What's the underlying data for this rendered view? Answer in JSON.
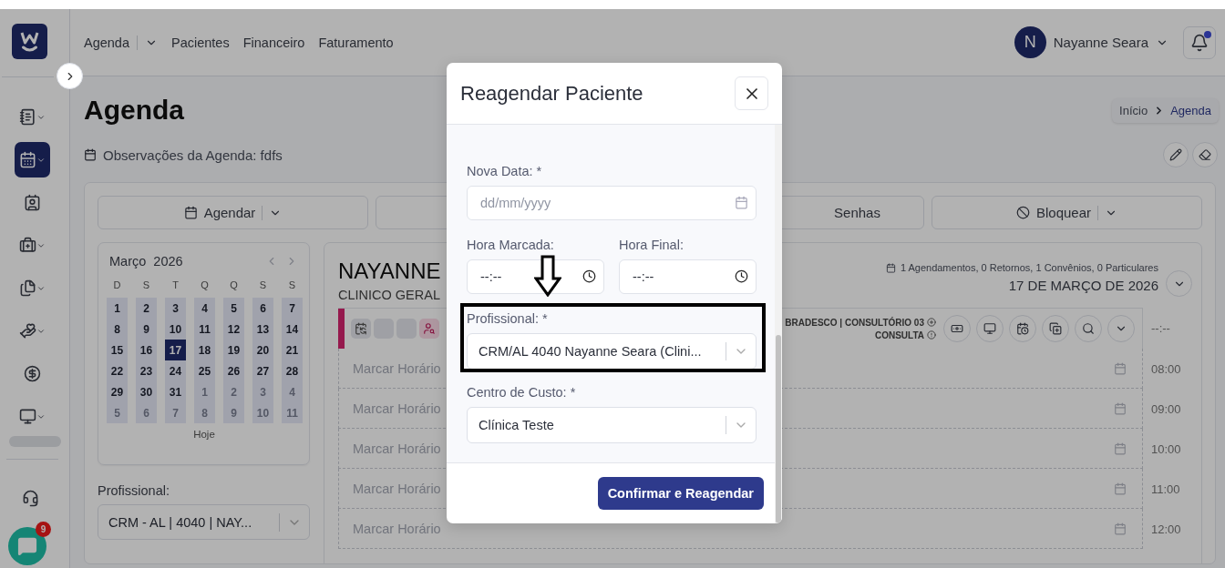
{
  "nav": {
    "links": [
      {
        "label": "Agenda",
        "dropdown": true
      },
      {
        "label": "Pacientes",
        "dropdown": false
      },
      {
        "label": "Financeiro",
        "dropdown": false
      },
      {
        "label": "Faturamento",
        "dropdown": false
      }
    ]
  },
  "user": {
    "initial": "N",
    "name": "Nayanne Seara"
  },
  "notifications": {
    "unread": true
  },
  "sidebar": {
    "items": [
      {
        "dropdown": true,
        "selected": false
      },
      {
        "dropdown": true,
        "selected": true
      },
      {
        "dropdown": false,
        "selected": false
      },
      {
        "dropdown": true,
        "selected": false
      },
      {
        "dropdown": true,
        "selected": false
      },
      {
        "dropdown": true,
        "selected": false
      },
      {
        "dropdown": false,
        "selected": false
      },
      {
        "dropdown": true,
        "selected": false
      }
    ]
  },
  "chat": {
    "badge": "9"
  },
  "page": {
    "title": "Agenda",
    "notes": "Observações da Agenda: fdfs",
    "breadcrumb": [
      {
        "label": "Início",
        "current": false
      },
      {
        "label": "Agenda",
        "current": true
      }
    ]
  },
  "actions": [
    {
      "label": "Agendar",
      "dropdown": true
    },
    {
      "label": "Senhas"
    },
    {
      "label": "Bloquear",
      "dropdown": true
    }
  ],
  "calendar": {
    "month": "Março",
    "year": "2026",
    "weekdays": [
      "D",
      "S",
      "T",
      "Q",
      "Q",
      "S",
      "S"
    ],
    "today": "Hoje",
    "weeks": [
      [
        {
          "day": "1",
          "outside": false,
          "selected": false
        },
        {
          "day": "2",
          "outside": false,
          "selected": false
        },
        {
          "day": "3",
          "outside": false,
          "selected": false
        },
        {
          "day": "4",
          "outside": false,
          "selected": false
        },
        {
          "day": "5",
          "outside": false,
          "selected": false
        },
        {
          "day": "6",
          "outside": false,
          "selected": false
        },
        {
          "day": "7",
          "outside": false,
          "selected": false
        }
      ],
      [
        {
          "day": "8",
          "outside": false,
          "selected": false
        },
        {
          "day": "9",
          "outside": false,
          "selected": false
        },
        {
          "day": "10",
          "outside": false,
          "selected": false
        },
        {
          "day": "11",
          "outside": false,
          "selected": false
        },
        {
          "day": "12",
          "outside": false,
          "selected": false
        },
        {
          "day": "13",
          "outside": false,
          "selected": false
        },
        {
          "day": "14",
          "outside": false,
          "selected": false
        }
      ],
      [
        {
          "day": "15",
          "outside": false,
          "selected": false
        },
        {
          "day": "16",
          "outside": false,
          "selected": false
        },
        {
          "day": "17",
          "outside": false,
          "selected": true
        },
        {
          "day": "18",
          "outside": false,
          "selected": false
        },
        {
          "day": "19",
          "outside": false,
          "selected": false
        },
        {
          "day": "20",
          "outside": false,
          "selected": false
        },
        {
          "day": "21",
          "outside": false,
          "selected": false
        }
      ],
      [
        {
          "day": "22",
          "outside": false,
          "selected": false
        },
        {
          "day": "23",
          "outside": false,
          "selected": false
        },
        {
          "day": "24",
          "outside": false,
          "selected": false
        },
        {
          "day": "25",
          "outside": false,
          "selected": false
        },
        {
          "day": "26",
          "outside": false,
          "selected": false
        },
        {
          "day": "27",
          "outside": false,
          "selected": false
        },
        {
          "day": "28",
          "outside": false,
          "selected": false
        }
      ],
      [
        {
          "day": "29",
          "outside": false,
          "selected": false
        },
        {
          "day": "30",
          "outside": false,
          "selected": false
        },
        {
          "day": "31",
          "outside": false,
          "selected": false
        },
        {
          "day": "1",
          "outside": true,
          "selected": false
        },
        {
          "day": "2",
          "outside": true,
          "selected": false
        },
        {
          "day": "3",
          "outside": true,
          "selected": false
        },
        {
          "day": "4",
          "outside": true,
          "selected": false
        }
      ],
      [
        {
          "day": "5",
          "outside": true,
          "selected": false
        },
        {
          "day": "6",
          "outside": true,
          "selected": false
        },
        {
          "day": "7",
          "outside": true,
          "selected": false
        },
        {
          "day": "8",
          "outside": true,
          "selected": false
        },
        {
          "day": "9",
          "outside": true,
          "selected": false
        },
        {
          "day": "10",
          "outside": true,
          "selected": false
        },
        {
          "day": "11",
          "outside": true,
          "selected": false
        }
      ]
    ]
  },
  "filter": {
    "label": "Profissional:",
    "value": "CRM - AL | 4040 | NAY..."
  },
  "schedule": {
    "doctor": "NAYANNE",
    "specialty": "CLINICO GERAL",
    "summary": "1 Agendamentos, 0 Retornos, 1 Convênios, 0 Particulares",
    "date": "17 DE MARÇO DE 2026",
    "header_line1": "BRADESCO | CONSULTÓRIO 03",
    "header_line2": "CONSULTA",
    "header_time": "--:--",
    "slots": [
      {
        "label": "Marcar Horário",
        "time": "08:00"
      },
      {
        "label": "Marcar Horário",
        "time": "09:00"
      },
      {
        "label": "Marcar Horário",
        "time": "10:00"
      },
      {
        "label": "Marcar Horário",
        "time": "11:00"
      },
      {
        "label": "Marcar Horário",
        "time": "12:00"
      }
    ]
  },
  "modal": {
    "title": "Reagendar Paciente",
    "date": {
      "label": "Nova Data: *",
      "placeholder": "dd/mm/yyyy"
    },
    "start_time": {
      "label": "Hora Marcada:",
      "value": "--:--"
    },
    "end_time": {
      "label": "Hora Final:",
      "value": "--:--"
    },
    "professional": {
      "label": "Profissional: *",
      "value": "CRM/AL 4040 Nayanne Seara (Clini...",
      "highlighted": true
    },
    "cost_center": {
      "label": "Centro de Custo: *",
      "value": "Clínica Teste"
    },
    "confirm": "Confirmar e Reagendar"
  }
}
